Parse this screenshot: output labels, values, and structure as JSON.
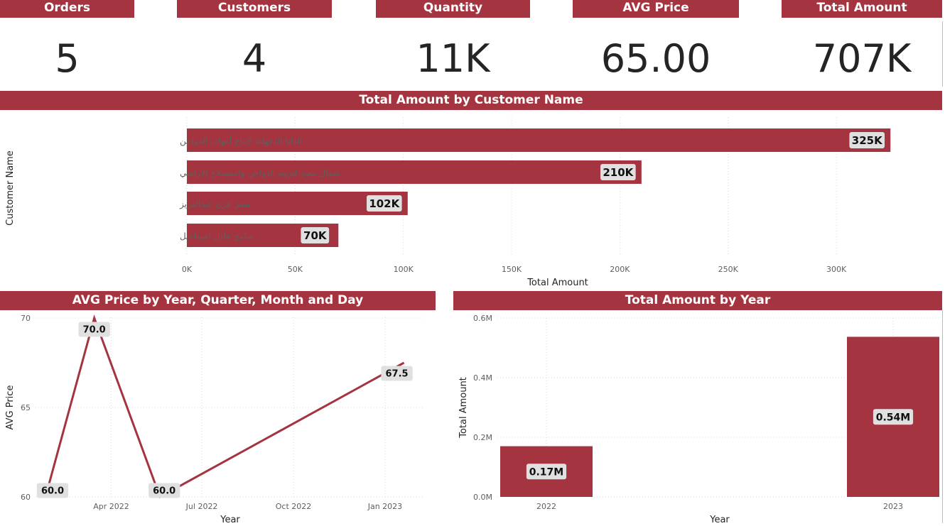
{
  "kpis": [
    {
      "title": "Orders",
      "value": "5"
    },
    {
      "title": "Customers",
      "value": "4"
    },
    {
      "title": "Quantity",
      "value": "11K"
    },
    {
      "title": "AVG Price",
      "value": "65.00"
    },
    {
      "title": "Total Amount",
      "value": "707K"
    }
  ],
  "customer_chart": {
    "title": "Total Amount by Customer Name",
    "xlabel": "Total Amount",
    "ylabel": "Customer Name"
  },
  "avg_price_chart": {
    "title": "AVG Price by Year, Quarter, Month and Day",
    "xlabel": "Year",
    "ylabel": "AVG Price"
  },
  "year_chart": {
    "title": "Total Amount by Year",
    "xlabel": "Year",
    "ylabel": "Total Amount"
  },
  "colors": {
    "accent": "#a4343f",
    "label_bg": "#e0e0e0",
    "text": "#252423"
  },
  "chart_data": [
    {
      "type": "bar",
      "orientation": "horizontal",
      "title": "Total Amount by Customer Name",
      "xlabel": "Total Amount",
      "ylabel": "Customer Name",
      "categories": [
        "الدلتا الدقهلية لإنتاج أمهات الدواجن",
        "شمال مصر لتربية الدواجن واستصلاح الاراضي",
        "معتز عزى عبدالعزيز",
        "سامح عادل اسماعيل"
      ],
      "values": [
        325000,
        210000,
        102000,
        70000
      ],
      "data_labels": [
        "325K",
        "210K",
        "102K",
        "70K"
      ],
      "xlim": [
        0,
        340000
      ],
      "xticks": [
        0,
        50000,
        100000,
        150000,
        200000,
        250000,
        300000
      ],
      "xtick_labels": [
        "0K",
        "50K",
        "100K",
        "150K",
        "200K",
        "250K",
        "300K"
      ],
      "grid": true
    },
    {
      "type": "line",
      "title": "AVG Price by Year, Quarter, Month and Day",
      "xlabel": "Year",
      "ylabel": "AVG Price",
      "x": [
        "2022-01-25",
        "2022-03-15",
        "2022-05-20",
        "2023-01-20"
      ],
      "y": [
        60.0,
        70.0,
        60.0,
        67.5
      ],
      "point_labels": [
        "60.0",
        "70.0",
        "60.0",
        "67.5"
      ],
      "xlim": [
        "2022-01-15",
        "2023-02-10"
      ],
      "xticks": [
        "2022-04-01",
        "2022-07-01",
        "2022-10-01",
        "2023-01-01"
      ],
      "xtick_labels": [
        "Apr 2022",
        "Jul 2022",
        "Oct 2022",
        "Jan 2023"
      ],
      "ylim": [
        60,
        70
      ],
      "yticks": [
        60,
        65,
        70
      ],
      "ytick_labels": [
        "60",
        "65",
        "70"
      ],
      "grid": true
    },
    {
      "type": "bar",
      "title": "Total Amount by Year",
      "xlabel": "Year",
      "ylabel": "Total Amount",
      "categories": [
        "2022",
        "2023"
      ],
      "values": [
        170000,
        537000
      ],
      "data_labels": [
        "0.17M",
        "0.54M"
      ],
      "ylim": [
        0,
        600000
      ],
      "yticks": [
        0,
        200000,
        400000,
        600000
      ],
      "ytick_labels": [
        "0.0M",
        "0.2M",
        "0.4M",
        "0.6M"
      ],
      "grid": true
    }
  ]
}
